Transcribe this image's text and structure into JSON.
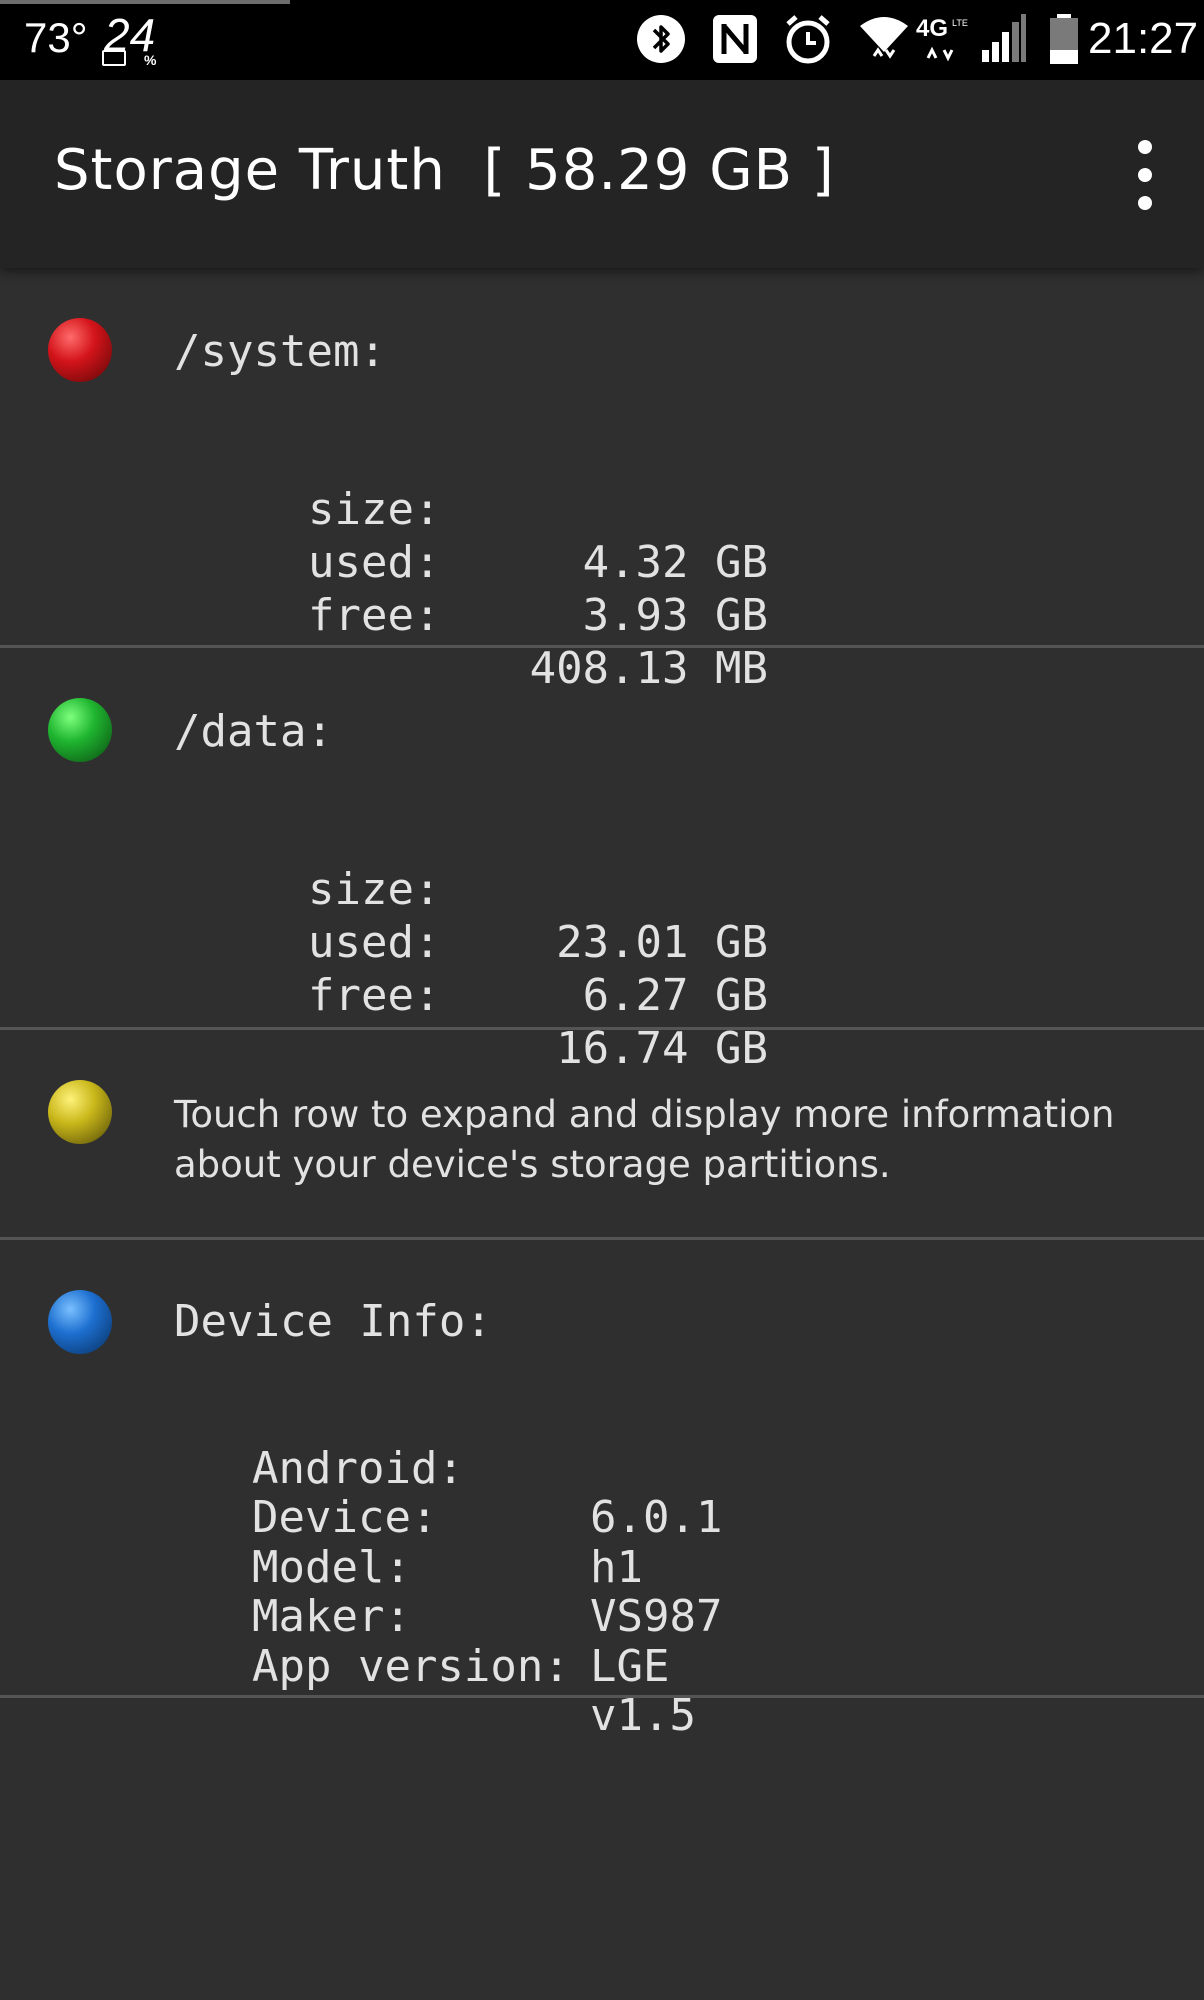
{
  "status_bar": {
    "temperature": "73°",
    "battery_percent": "24",
    "battery_percent_sign": "%",
    "time": "21:27",
    "icons": [
      "bluetooth-icon",
      "nfc-icon",
      "alarm-icon",
      "wifi-icon",
      "4g-lte-icon",
      "signal-icon",
      "battery-icon"
    ]
  },
  "app_bar": {
    "title": "Storage Truth  [ 58.29 GB ]",
    "overflow_icon": "more-vert-icon"
  },
  "partitions": [
    {
      "color": "red",
      "name": "/system:",
      "stats": [
        {
          "label": "size:",
          "value": "4.32 GB"
        },
        {
          "label": "used:",
          "value": "3.93 GB"
        },
        {
          "label": "free:",
          "value": "408.13 MB"
        }
      ]
    },
    {
      "color": "green",
      "name": "/data:",
      "stats": [
        {
          "label": "size:",
          "value": "23.01 GB"
        },
        {
          "label": "used:",
          "value": "6.27 GB"
        },
        {
          "label": "free:",
          "value": "16.74 GB"
        }
      ]
    }
  ],
  "hint": {
    "color": "yellow",
    "text": "Touch row to expand and display more information about your device's storage partitions."
  },
  "device_info": {
    "color": "blue",
    "title": "Device Info:",
    "rows": [
      {
        "label": "Android:",
        "value": "6.0.1"
      },
      {
        "label": "Device:",
        "value": "h1"
      },
      {
        "label": "Model:",
        "value": "VS987"
      },
      {
        "label": "Maker:",
        "value": "LGE"
      },
      {
        "label": "App version:",
        "value": "v1.5"
      }
    ]
  }
}
